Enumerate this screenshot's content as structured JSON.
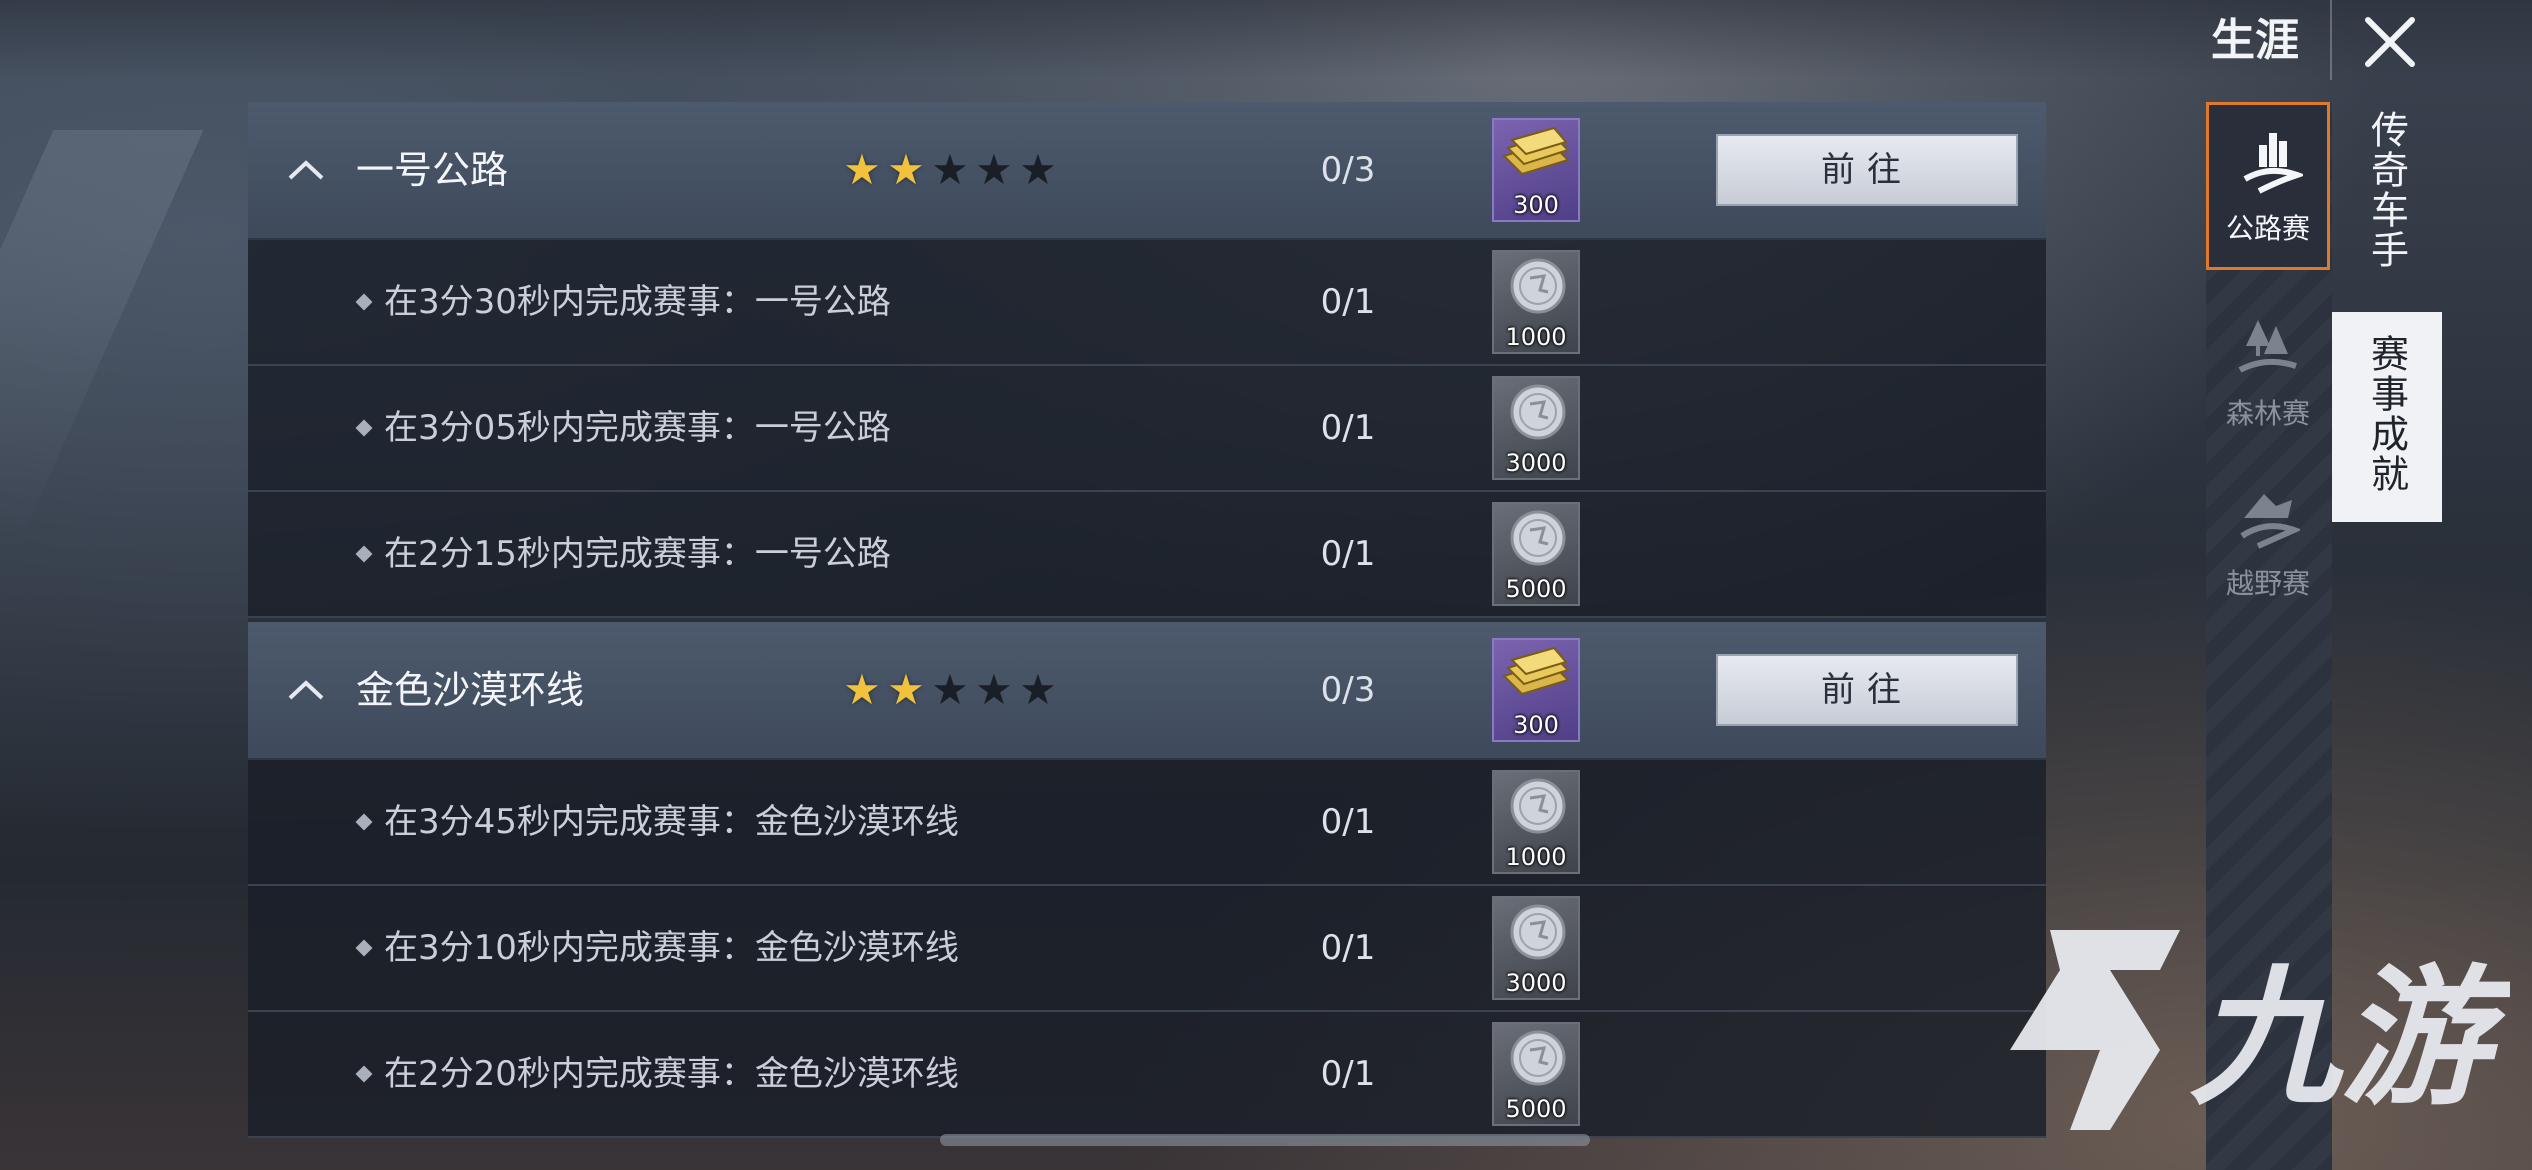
{
  "header": {
    "title": "生涯",
    "close_icon": "close-icon"
  },
  "sections": [
    {
      "name": "一号公路",
      "stars_filled": 2,
      "stars_total": 5,
      "progress": "0/3",
      "reward_amount": "300",
      "reward_icon": "cash-bundle-icon",
      "goto_label": "前往",
      "tasks": [
        {
          "text": "在3分30秒内完成赛事：一号公路",
          "progress": "0/1",
          "reward_amount": "1000",
          "reward_icon": "silver-coin-icon"
        },
        {
          "text": "在3分05秒内完成赛事：一号公路",
          "progress": "0/1",
          "reward_amount": "3000",
          "reward_icon": "silver-coin-icon"
        },
        {
          "text": "在2分15秒内完成赛事：一号公路",
          "progress": "0/1",
          "reward_amount": "5000",
          "reward_icon": "silver-coin-icon"
        }
      ]
    },
    {
      "name": "金色沙漠环线",
      "stars_filled": 2,
      "stars_total": 5,
      "progress": "0/3",
      "reward_amount": "300",
      "reward_icon": "cash-bundle-icon",
      "goto_label": "前往",
      "tasks": [
        {
          "text": "在3分45秒内完成赛事：金色沙漠环线",
          "progress": "0/1",
          "reward_amount": "1000",
          "reward_icon": "silver-coin-icon"
        },
        {
          "text": "在3分10秒内完成赛事：金色沙漠环线",
          "progress": "0/1",
          "reward_amount": "3000",
          "reward_icon": "silver-coin-icon"
        },
        {
          "text": "在2分20秒内完成赛事：金色沙漠环线",
          "progress": "0/1",
          "reward_amount": "5000",
          "reward_icon": "silver-coin-icon"
        }
      ]
    }
  ],
  "side_tabs": [
    {
      "label": "公路赛",
      "icon": "road-race-icon",
      "active": true
    },
    {
      "label": "森林赛",
      "icon": "forest-race-icon",
      "active": false
    },
    {
      "label": "越野赛",
      "icon": "offroad-race-icon",
      "active": false
    }
  ],
  "vertical_tabs": [
    {
      "label": "传奇车手",
      "selected": false
    },
    {
      "label": "赛事成就",
      "selected": true
    }
  ],
  "watermark": {
    "text": "九游"
  },
  "colors": {
    "accent": "#e07a2a",
    "star_on": "#f2c23c",
    "header_row": "#4d5a6d"
  }
}
